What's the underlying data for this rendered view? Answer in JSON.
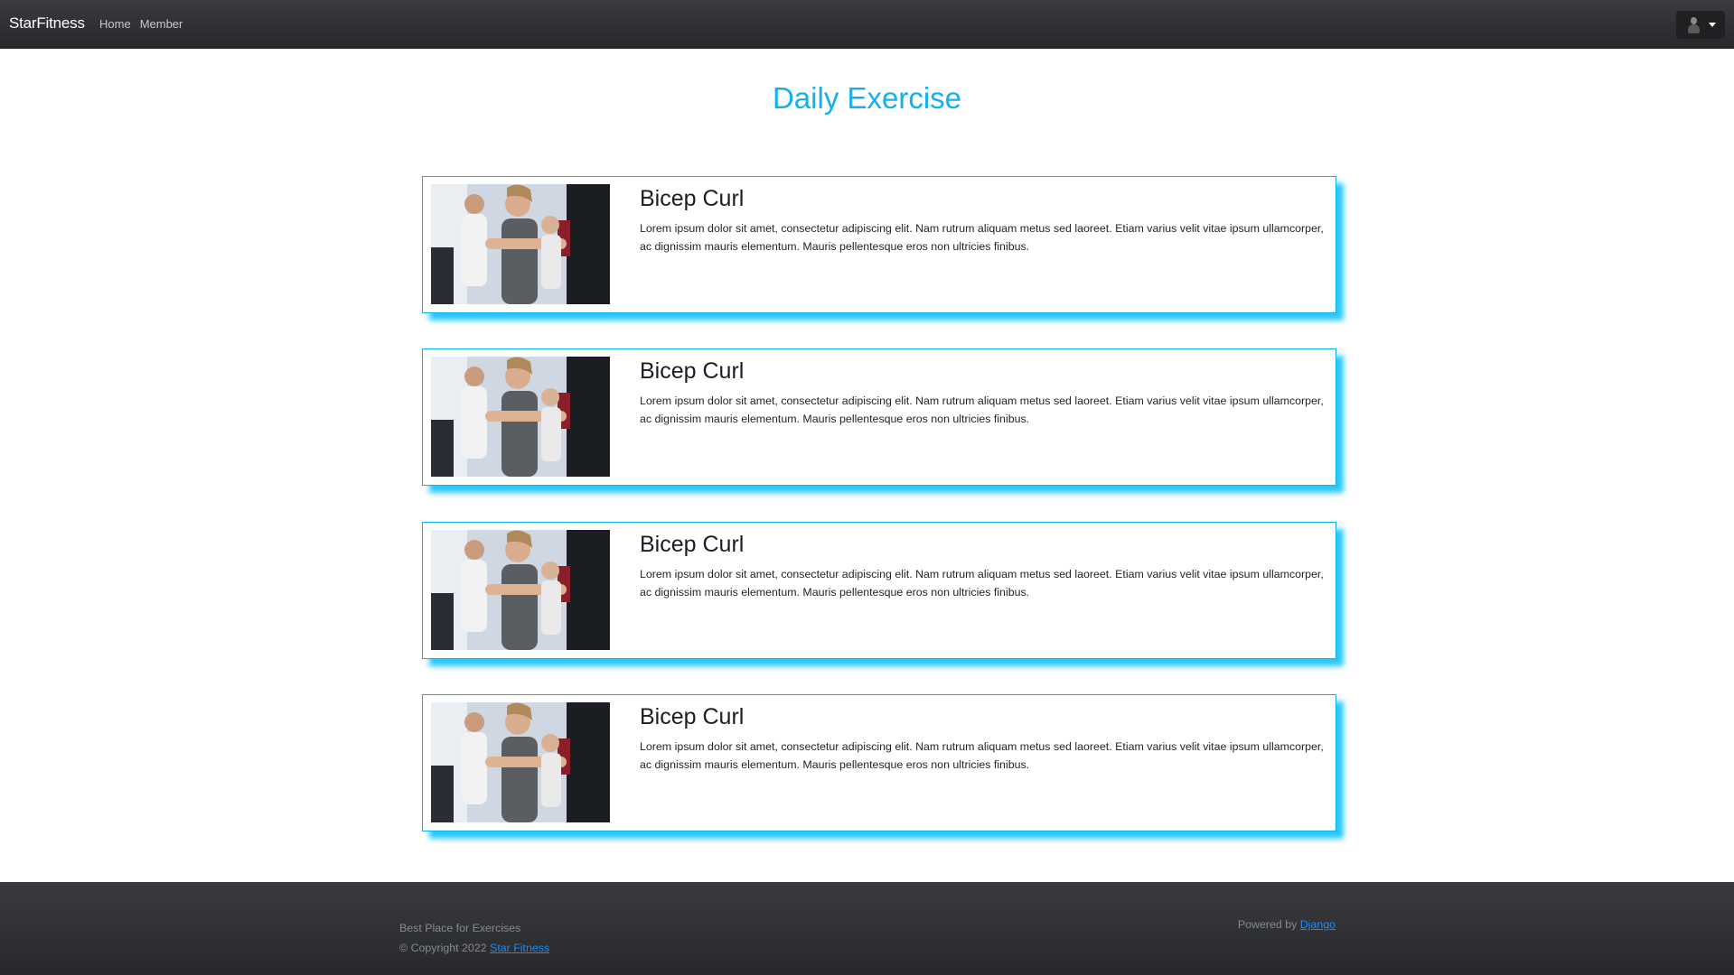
{
  "navbar": {
    "brand": "StarFitness",
    "links": [
      "Home",
      "Member"
    ]
  },
  "page": {
    "title": "Daily Exercise"
  },
  "exercises": [
    {
      "title": "Bicep Curl",
      "description": "Lorem ipsum dolor sit amet, consectetur adipiscing elit. Nam rutrum aliquam metus sed laoreet. Etiam varius velit vitae ipsum ullamcorper, ac dignissim mauris elementum. Mauris pellentesque eros non ultricies finibus."
    },
    {
      "title": "Bicep Curl",
      "description": "Lorem ipsum dolor sit amet, consectetur adipiscing elit. Nam rutrum aliquam metus sed laoreet. Etiam varius velit vitae ipsum ullamcorper, ac dignissim mauris elementum. Mauris pellentesque eros non ultricies finibus."
    },
    {
      "title": "Bicep Curl",
      "description": "Lorem ipsum dolor sit amet, consectetur adipiscing elit. Nam rutrum aliquam metus sed laoreet. Etiam varius velit vitae ipsum ullamcorper, ac dignissim mauris elementum. Mauris pellentesque eros non ultricies finibus."
    },
    {
      "title": "Bicep Curl",
      "description": "Lorem ipsum dolor sit amet, consectetur adipiscing elit. Nam rutrum aliquam metus sed laoreet. Etiam varius velit vitae ipsum ullamcorper, ac dignissim mauris elementum. Mauris pellentesque eros non ultricies finibus."
    }
  ],
  "footer": {
    "tagline": "Best Place for Exercises",
    "copyright_prefix": "© Copyright 2022",
    "copyright_link": "Star Fitness",
    "powered_prefix": "Powered by",
    "powered_link": "Django"
  },
  "colors": {
    "accent": "#12b1ee",
    "navbar": "#2f3033",
    "link": "#1a8cff"
  },
  "icons": {
    "user": "user-avatar-icon",
    "caret": "caret-down-icon"
  }
}
